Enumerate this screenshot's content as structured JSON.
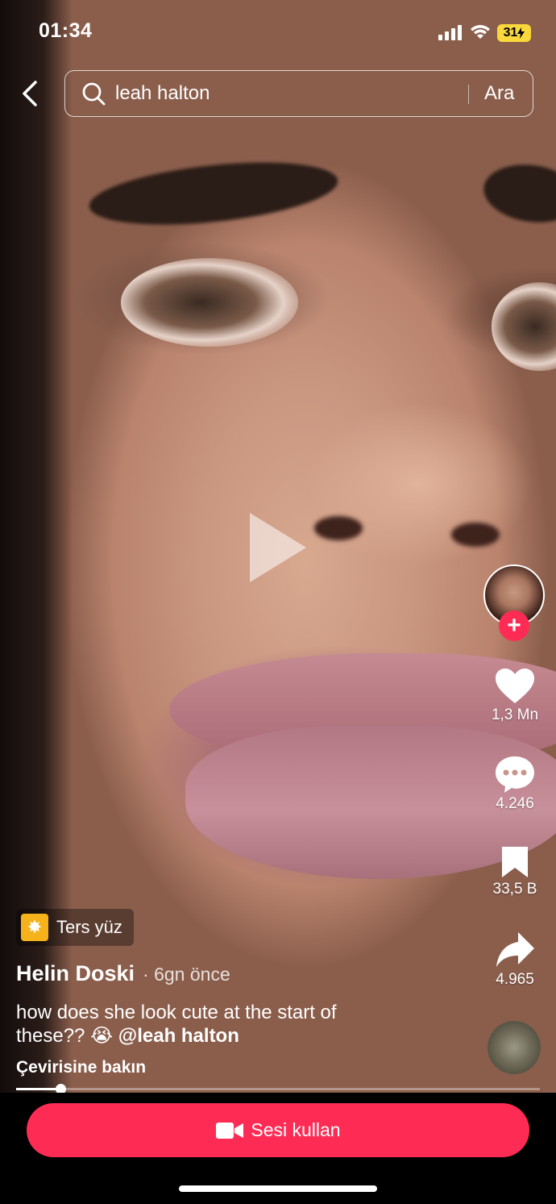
{
  "status_bar": {
    "time": "01:34",
    "battery": "31"
  },
  "search": {
    "query": "leah halton",
    "button_label": "Ara"
  },
  "video": {
    "progress_fraction": 0.084
  },
  "rail": {
    "likes": "1,3 Mn",
    "comments": "4.246",
    "saves": "33,5 B",
    "shares": "4.965"
  },
  "effect": {
    "label": "Ters yüz"
  },
  "post": {
    "author": "Helin Doski",
    "time_ago": "· 6gn önce",
    "caption": "how does she look cute at the start of these??",
    "emoji": "😭",
    "mention": "@leah halton",
    "translate_label": "Çevirisine bakın"
  },
  "bottom": {
    "use_sound_label": "Sesi kullan"
  },
  "colors": {
    "accent": "#fe2c55",
    "battery": "#f8d83a"
  },
  "icons": {
    "back": "chevron-left-icon",
    "search": "search-icon",
    "like": "heart-icon",
    "comment": "comment-bubble-icon",
    "save": "bookmark-icon",
    "share": "share-arrow-icon",
    "camera": "video-camera-icon"
  }
}
